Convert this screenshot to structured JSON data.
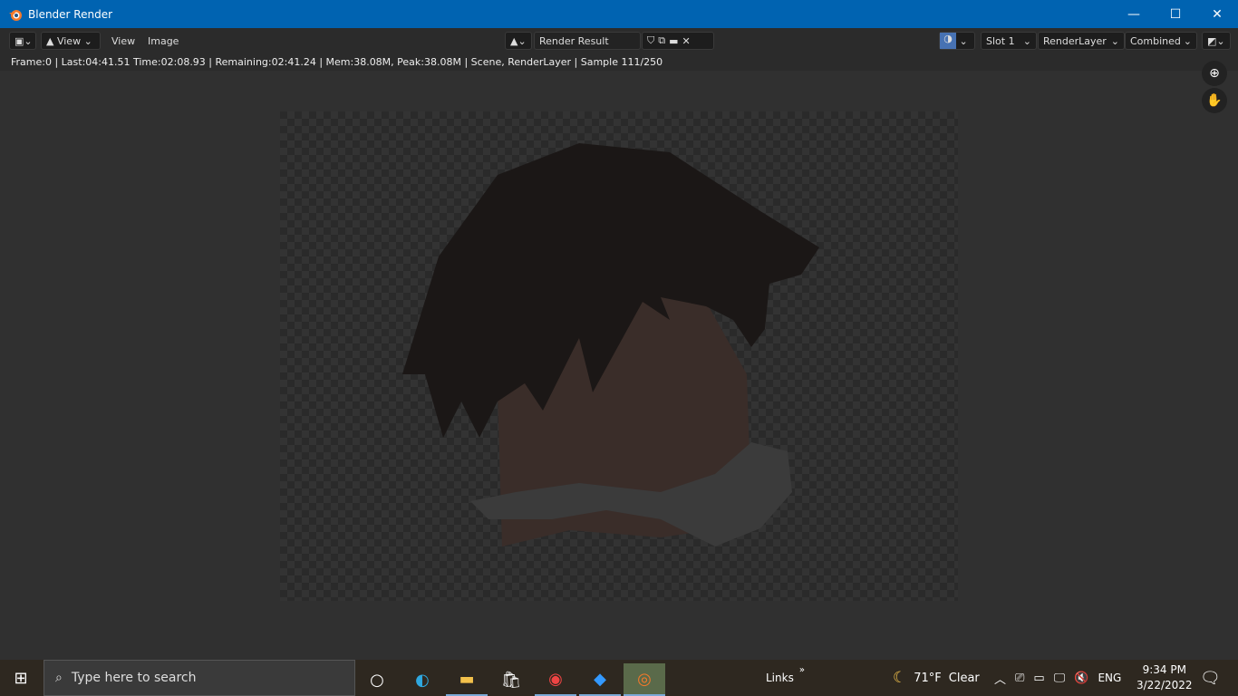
{
  "window": {
    "title": "Blender Render",
    "minimize": "—",
    "maximize": "☐",
    "close": "✕"
  },
  "header": {
    "view_dropdown": "View",
    "menu_view": "View",
    "menu_image": "Image",
    "image_name": "Render Result",
    "slot": "Slot 1",
    "layer": "RenderLayer",
    "pass": "Combined"
  },
  "status": "Frame:0 | Last:04:41.51 Time:02:08.93 | Remaining:02:41.24 | Mem:38.08M, Peak:38.08M | Scene, RenderLayer | Sample 111/250",
  "taskbar": {
    "search_placeholder": "Type here to search",
    "links": "Links",
    "weather_temp": "71°F",
    "weather_desc": "Clear",
    "language": "ENG",
    "time": "9:34 PM",
    "date": "3/22/2022"
  },
  "colors": {
    "titlebar": "#0063b1",
    "accent": "#4772b3"
  }
}
